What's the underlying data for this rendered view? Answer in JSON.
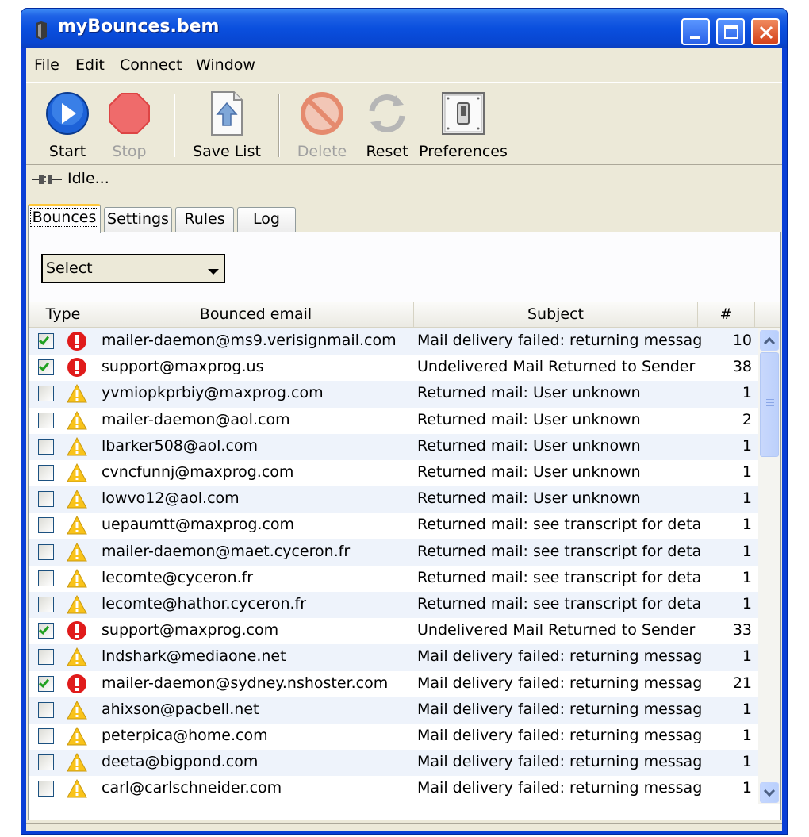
{
  "window": {
    "title": "myBounces.bem",
    "controls": {
      "minimize": "minimize-icon",
      "maximize": "maximize-icon",
      "close": "close-icon"
    }
  },
  "menu": [
    "File",
    "Edit",
    "Connect",
    "Window"
  ],
  "toolbar": {
    "start": "Start",
    "stop": "Stop",
    "save_list": "Save List",
    "delete": "Delete",
    "reset": "Reset",
    "preferences": "Preferences"
  },
  "status": {
    "text": "Idle...",
    "icon": "plug-icon"
  },
  "tabs": [
    "Bounces",
    "Settings",
    "Rules",
    "Log"
  ],
  "active_tab": "Bounces",
  "filter": {
    "selected": "Select"
  },
  "table": {
    "columns": [
      "Type",
      "Bounced email",
      "Subject",
      "#"
    ],
    "rows": [
      {
        "checked": true,
        "type": "error",
        "email": "mailer-daemon@ms9.verisignmail.com",
        "subject": "Mail delivery failed: returning message ...",
        "count": "10"
      },
      {
        "checked": true,
        "type": "error",
        "email": "support@maxprog.us",
        "subject": "Undelivered Mail Returned to Sender",
        "count": "38"
      },
      {
        "checked": false,
        "type": "warning",
        "email": "yvmiopkprbiy@maxprog.com",
        "subject": "Returned mail: User unknown",
        "count": "1"
      },
      {
        "checked": false,
        "type": "warning",
        "email": "mailer-daemon@aol.com",
        "subject": "Returned mail: User unknown",
        "count": "2"
      },
      {
        "checked": false,
        "type": "warning",
        "email": "lbarker508@aol.com",
        "subject": "Returned mail: User unknown",
        "count": "1"
      },
      {
        "checked": false,
        "type": "warning",
        "email": "cvncfunnj@maxprog.com",
        "subject": "Returned mail: User unknown",
        "count": "1"
      },
      {
        "checked": false,
        "type": "warning",
        "email": "lowvo12@aol.com",
        "subject": "Returned mail: User unknown",
        "count": "1"
      },
      {
        "checked": false,
        "type": "warning",
        "email": "uepaumtt@maxprog.com",
        "subject": "Returned mail: see transcript for details",
        "count": "1"
      },
      {
        "checked": false,
        "type": "warning",
        "email": "mailer-daemon@maet.cyceron.fr",
        "subject": "Returned mail: see transcript for details",
        "count": "1"
      },
      {
        "checked": false,
        "type": "warning",
        "email": "lecomte@cyceron.fr",
        "subject": "Returned mail: see transcript for details",
        "count": "1"
      },
      {
        "checked": false,
        "type": "warning",
        "email": "lecomte@hathor.cyceron.fr",
        "subject": "Returned mail: see transcript for details",
        "count": "1"
      },
      {
        "checked": true,
        "type": "error",
        "email": "support@maxprog.com",
        "subject": "Undelivered Mail Returned to Sender",
        "count": "33"
      },
      {
        "checked": false,
        "type": "warning",
        "email": "lndshark@mediaone.net",
        "subject": "Mail delivery failed: returning message ...",
        "count": "1"
      },
      {
        "checked": true,
        "type": "error",
        "email": "mailer-daemon@sydney.nshoster.com",
        "subject": "Mail delivery failed: returning message ...",
        "count": "21"
      },
      {
        "checked": false,
        "type": "warning",
        "email": "ahixson@pacbell.net",
        "subject": "Mail delivery failed: returning message ...",
        "count": "1"
      },
      {
        "checked": false,
        "type": "warning",
        "email": "peterpica@home.com",
        "subject": "Mail delivery failed: returning message ...",
        "count": "1"
      },
      {
        "checked": false,
        "type": "warning",
        "email": "deeta@bigpond.com",
        "subject": "Mail delivery failed: returning message ...",
        "count": "1"
      },
      {
        "checked": false,
        "type": "warning",
        "email": "carl@carlschneider.com",
        "subject": "Mail delivery failed: returning message ...",
        "count": "1"
      }
    ]
  },
  "colors": {
    "title_bar": "#0a4fde",
    "client": "#ece9d8",
    "row_alt": "#eef3fb",
    "error": "#e01b1b",
    "warning": "#f9c31a"
  }
}
